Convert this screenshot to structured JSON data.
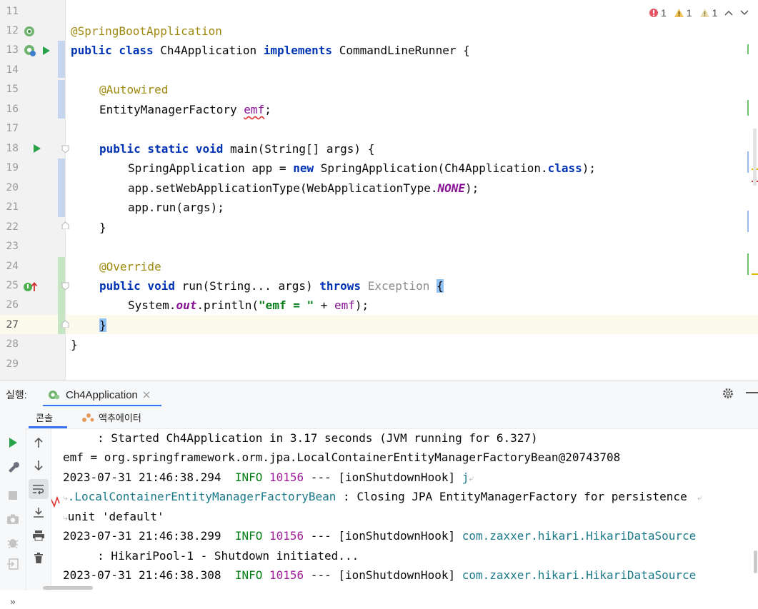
{
  "editor": {
    "status": {
      "errors": "1",
      "warnings": "1",
      "weak_warnings": "1"
    },
    "lines": [
      {
        "n": "11"
      },
      {
        "n": "12",
        "t1": "@SpringBootApplication"
      },
      {
        "n": "13",
        "kw1": "public class ",
        "t1": "Ch4Application ",
        "kw2": "implements ",
        "t2": "CommandLineRunner {"
      },
      {
        "n": "14"
      },
      {
        "n": "15",
        "ann": "@Autowired"
      },
      {
        "n": "16",
        "t1": "EntityManagerFactory ",
        "fld": "emf",
        "t2": ";"
      },
      {
        "n": "17"
      },
      {
        "n": "18",
        "kw1": "public static void ",
        "t1": "main(String[] args) {"
      },
      {
        "n": "19",
        "t1": "SpringApplication app = ",
        "kw1": "new ",
        "t2": "SpringApplication(Ch4Application.",
        "kw2": "class",
        "t3": ");"
      },
      {
        "n": "20",
        "t1": "app.setWebApplicationType(WebApplicationType.",
        "sto": "NONE",
        "t2": ");"
      },
      {
        "n": "21",
        "t1": "app.run(args);"
      },
      {
        "n": "22",
        "t1": "}"
      },
      {
        "n": "23"
      },
      {
        "n": "24",
        "ann": "@Override"
      },
      {
        "n": "25",
        "kw1": "public void ",
        "t1": "run(String... args) ",
        "kw2": "throws ",
        "grey": "Exception ",
        "brace": "{"
      },
      {
        "n": "26",
        "t1": "System.",
        "sto": "out",
        "t2": ".println(",
        "str": "\"emf = \"",
        "t3": " + ",
        "fld": "emf",
        "t4": ");"
      },
      {
        "n": "27",
        "brace": "}"
      },
      {
        "n": "28",
        "t1": "}"
      },
      {
        "n": "29"
      }
    ]
  },
  "run": {
    "label": "실행:",
    "config_name": "Ch4Application",
    "tabs": {
      "console": "콘솔",
      "actuator": "액추에이터"
    },
    "console": [
      {
        "a": "     : Started Ch4Application in 3.17 seconds (JVM running for 6.327)"
      },
      {
        "a": "emf = org.springframework.orm.jpa.LocalContainerEntityManagerFactoryBean@20743708"
      },
      {
        "a": "2023-07-31 21:46:38.294  ",
        "info": "INFO",
        "sp": " ",
        "pid": "10156",
        "b": " --- [ionShutdownHook] ",
        "cls": "j"
      },
      {
        "cls": ".LocalContainerEntityManagerFactoryBean",
        "b": " : Closing JPA EntityManagerFactory for persistence"
      },
      {
        "a": "unit 'default'"
      },
      {
        "a": "2023-07-31 21:46:38.299  ",
        "info": "INFO",
        "sp": " ",
        "pid": "10156",
        "b": " --- [ionShutdownHook] ",
        "cls": "com.zaxxer.hikari.HikariDataSource"
      },
      {
        "a": "     : HikariPool-1 - Shutdown initiated..."
      },
      {
        "a": "2023-07-31 21:46:38.308  ",
        "info": "INFO",
        "sp": " ",
        "pid": "10156",
        "b": " --- [ionShutdownHook] ",
        "cls": "com.zaxxer.hikari.HikariDataSource"
      }
    ]
  }
}
